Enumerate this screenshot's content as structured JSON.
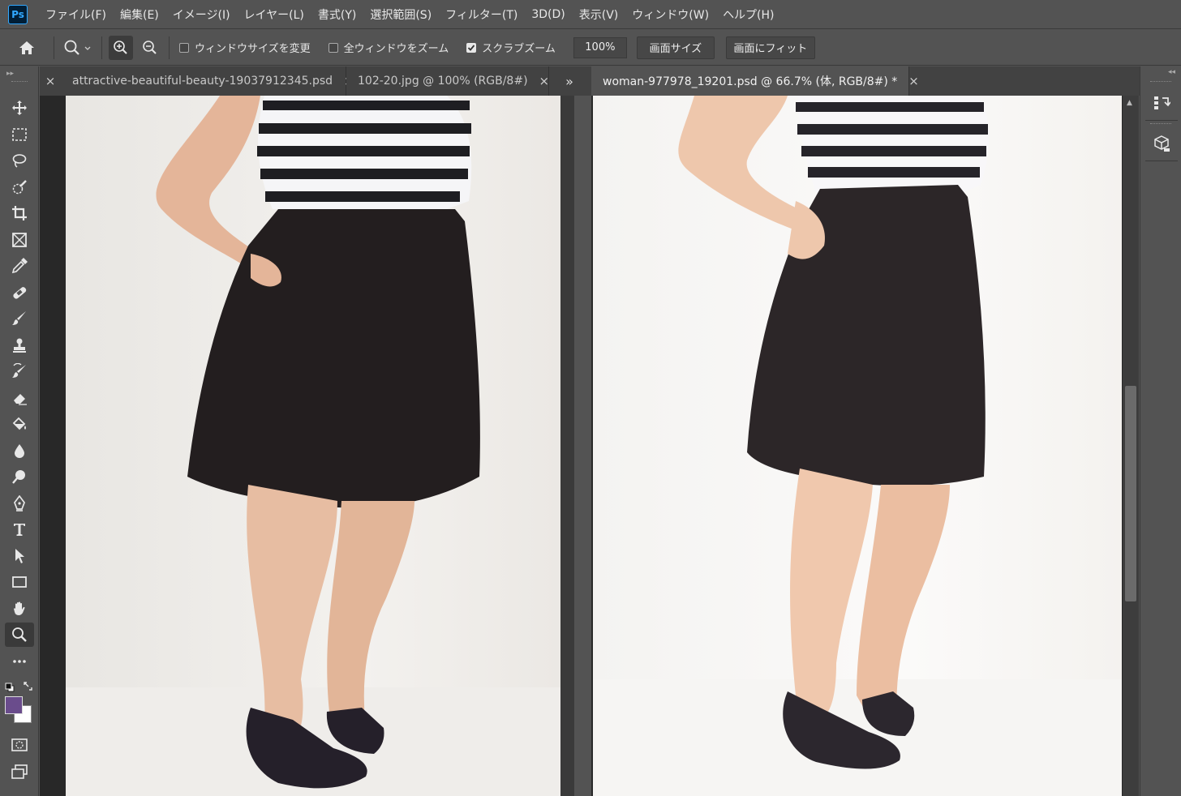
{
  "app": {
    "logo": "Ps"
  },
  "menu": [
    "ファイル(F)",
    "編集(E)",
    "イメージ(I)",
    "レイヤー(L)",
    "書式(Y)",
    "選択範囲(S)",
    "フィルター(T)",
    "3D(D)",
    "表示(V)",
    "ウィンドウ(W)",
    "ヘルプ(H)"
  ],
  "options": {
    "resize_windows": {
      "label": "ウィンドウサイズを変更",
      "checked": false
    },
    "zoom_all": {
      "label": "全ウィンドウをズーム",
      "checked": false
    },
    "scrubby_zoom": {
      "label": "スクラブズーム",
      "checked": true
    },
    "zoom_value": "100%",
    "actual_size_btn": "画面サイズ",
    "fit_screen_btn": "画面にフィット"
  },
  "tabs_left": [
    {
      "title": "attractive-beautiful-beauty-19037912345.psd",
      "close": "×"
    },
    {
      "title": "102-20.jpg @ 100% (RGB/8#)",
      "close": "×"
    }
  ],
  "tabs_overflow": "»",
  "tab_right": {
    "title": "woman-977978_19201.psd  @  66.7% (体, RGB/8#) *",
    "close": "×"
  },
  "left_close": "×",
  "colors": {
    "foreground": "#6a4c8c",
    "background": "#ffffff",
    "accent": "#31a8ff"
  },
  "tools": [
    "move-icon",
    "marquee-icon",
    "lasso-icon",
    "quick-select-icon",
    "crop-icon",
    "frame-icon",
    "eyedropper-icon",
    "healing-icon",
    "brush-icon",
    "stamp-icon",
    "history-brush-icon",
    "eraser-icon",
    "paint-bucket-icon",
    "blur-icon",
    "dodge-icon",
    "pen-icon",
    "type-icon",
    "path-select-icon",
    "rectangle-icon",
    "hand-icon",
    "zoom-icon",
    "more-icon"
  ]
}
